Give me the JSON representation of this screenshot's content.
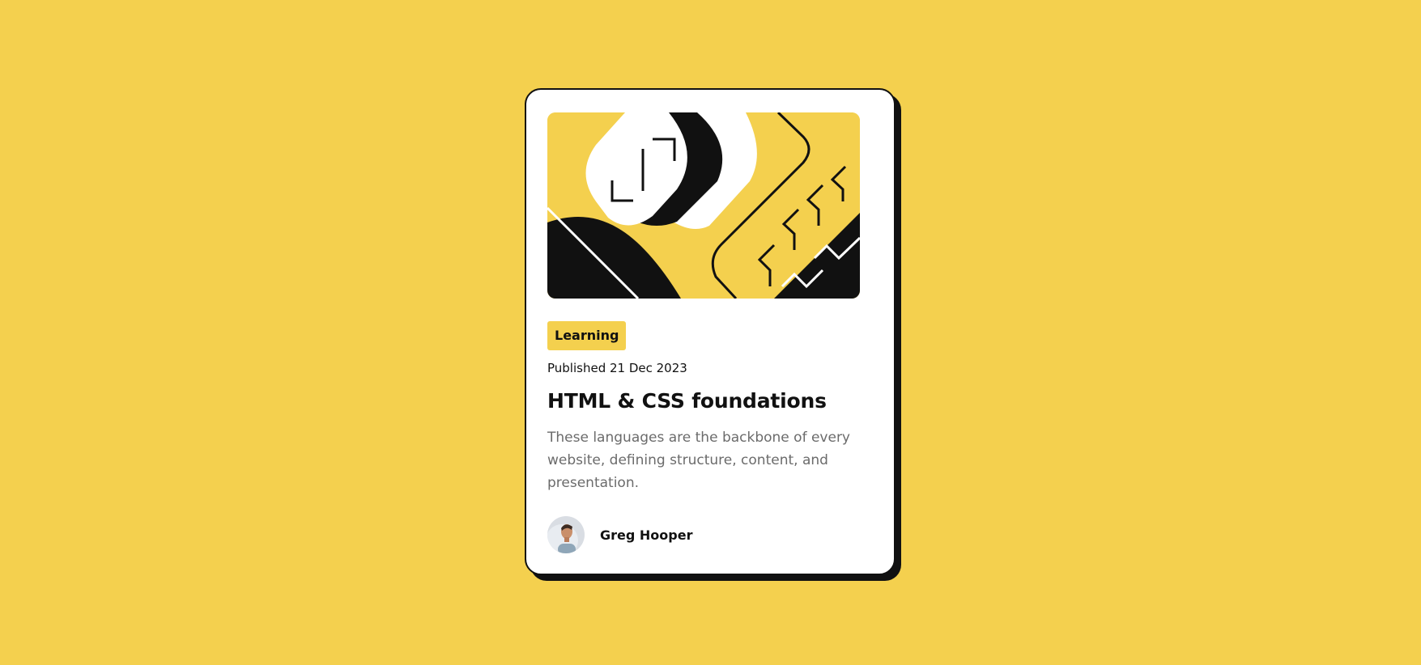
{
  "card": {
    "category": "Learning",
    "published": "Published 21 Dec 2023",
    "title": "HTML & CSS foundations",
    "description": "These languages are the backbone of every website, defining structure, content, and presentation.",
    "author": {
      "name": "Greg Hooper",
      "avatar_icon": "person-portrait-icon"
    },
    "illustration": "abstract-code-illustration"
  },
  "colors": {
    "background": "#F4D04E",
    "card": "#FFFFFF",
    "ink": "#111111",
    "muted_text": "#6B6B6B"
  }
}
